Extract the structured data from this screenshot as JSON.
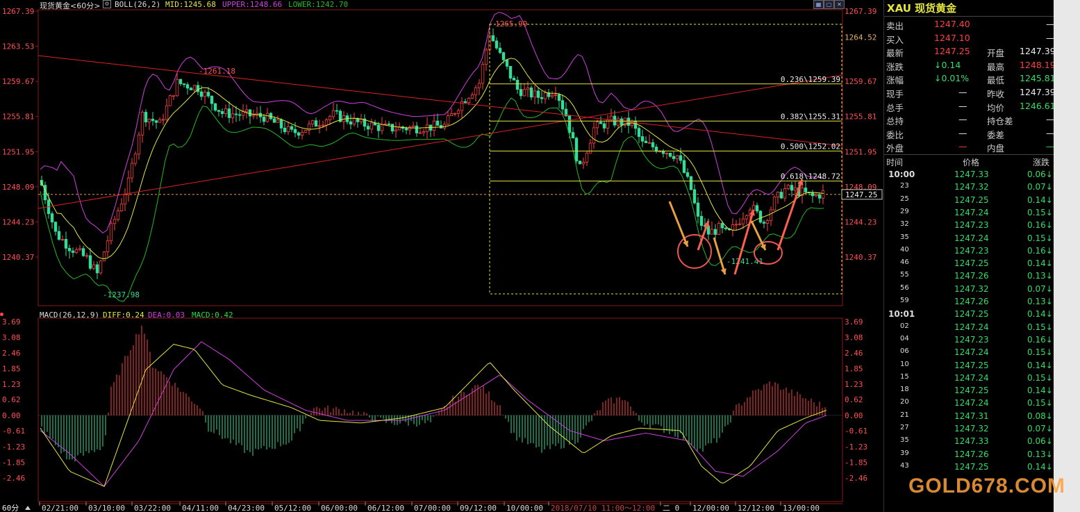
{
  "header": {
    "symbol_label": "现货黄金<60分>",
    "boll_label": "BOLL(26,2)",
    "mid_label": "MID:1245.68",
    "upper_label": "UPPER:1248.66",
    "lower_label": "LOWER:1242.70",
    "macd_label": "MACD(26,12,9)",
    "diff_label": "DIFF:0.24",
    "dea_label": "DEA:0.03",
    "macd_val_label": "MACD:0.42"
  },
  "colors": {
    "up": "#ff4444",
    "down": "#33dd99",
    "mid": "#e6e640",
    "upper": "#d040e0",
    "lower": "#22bb22",
    "fib": "#e6e640",
    "trend": "#dd2222",
    "price_text": "#ff5050"
  },
  "price_axis": {
    "left_labels": [
      "1267.39",
      "1263.53",
      "1259.67",
      "1255.81",
      "1251.95",
      "1248.09",
      "1244.23",
      "1240.37"
    ],
    "right_labels": [
      "1267.39",
      "1264.52",
      "1259.67",
      "1255.81",
      "1251.95",
      "1248.09",
      "1244.23",
      "1240.37"
    ],
    "current_price_box": "1247.25"
  },
  "macd_axis": {
    "left_labels": [
      "3.69",
      "3.08",
      "2.46",
      "1.85",
      "1.23",
      "0.62",
      "0.00",
      "-0.61",
      "-1.23",
      "-1.85",
      "-2.46"
    ],
    "right_labels": [
      "3.69",
      "3.08",
      "2.46",
      "1.85",
      "1.23",
      "0.62",
      "0.00",
      "-0.61",
      "-1.23",
      "-1.85",
      "-2.46"
    ]
  },
  "annotations": {
    "high_label": "1265.99",
    "swing_high_label": "1261.18",
    "low_label": "1237.98",
    "recent_low_label": "1241.41",
    "fib": [
      {
        "label": "0.236\\1259.39",
        "price": 1259.39
      },
      {
        "label": "0.382\\1255.31",
        "price": 1255.31
      },
      {
        "label": "0.500\\1252.02",
        "price": 1252.02
      },
      {
        "label": "0.618\\1248.72",
        "price": 1248.72
      }
    ]
  },
  "time_axis": {
    "period_label": "60分",
    "labels": [
      "02/21:00",
      "03/10:00",
      "03/22:00",
      "04/11:00",
      "04/23:00",
      "05/12:00",
      "06/00:00",
      "06/12:00",
      "07/00:00",
      "09/12:00",
      "10/00:00",
      "2018/07/10 11:00～12:00",
      "二 0",
      "12/00:00",
      "12/12:00",
      "13/00:00"
    ]
  },
  "side_panel": {
    "title": "XAU 现货黄金",
    "quote_rows": [
      {
        "l1": "卖出",
        "v1": "1247.40",
        "l2": "",
        "v2": "—",
        "c1": "red"
      },
      {
        "l1": "买入",
        "v1": "1247.10",
        "l2": "",
        "v2": "—",
        "c1": "red"
      },
      {
        "l1": "最新",
        "v1": "1247.25",
        "l2": "开盘",
        "v2": "1247.39",
        "c1": "red"
      },
      {
        "l1": "涨跌",
        "v1": "↓0.14",
        "l2": "最高",
        "v2": "1248.19",
        "c1": "green",
        "c2": "red"
      },
      {
        "l1": "涨幅",
        "v1": "↓0.01%",
        "l2": "最低",
        "v2": "1245.81",
        "c1": "green",
        "c2": "green"
      },
      {
        "l1": "现手",
        "v1": "—",
        "l2": "昨收",
        "v2": "1247.39"
      },
      {
        "l1": "总手",
        "v1": "—",
        "l2": "均价",
        "v2": "1246.61",
        "c2": "green"
      },
      {
        "l1": "总持",
        "v1": "—",
        "l2": "持仓差",
        "v2": "—"
      },
      {
        "l1": "委比",
        "v1": "—",
        "l2": "委差",
        "v2": "—"
      },
      {
        "l1": "外盘",
        "v1": "—",
        "l2": "内盘",
        "v2": "—",
        "c1": "red",
        "c2": "green"
      }
    ],
    "tick_headers": [
      "时间",
      "价格",
      "涨跌"
    ],
    "ticks": [
      {
        "t": "10:00",
        "p": "1247.33",
        "c": "0.06↓"
      },
      {
        "t": "23",
        "p": "1247.32",
        "c": "0.07↓"
      },
      {
        "t": "25",
        "p": "1247.25",
        "c": "0.14↓"
      },
      {
        "t": "29",
        "p": "1247.24",
        "c": "0.15↓"
      },
      {
        "t": "32",
        "p": "1247.23",
        "c": "0.16↓"
      },
      {
        "t": "35",
        "p": "1247.24",
        "c": "0.15↓"
      },
      {
        "t": "40",
        "p": "1247.23",
        "c": "0.16↓"
      },
      {
        "t": "46",
        "p": "1247.25",
        "c": "0.14↓"
      },
      {
        "t": "55",
        "p": "1247.26",
        "c": "0.13↓"
      },
      {
        "t": "56",
        "p": "1247.32",
        "c": "0.07↓"
      },
      {
        "t": "59",
        "p": "1247.26",
        "c": "0.13↓"
      },
      {
        "t": "10:01",
        "p": "1247.25",
        "c": "0.14↓"
      },
      {
        "t": "02",
        "p": "1247.24",
        "c": "0.15↓"
      },
      {
        "t": "04",
        "p": "1247.23",
        "c": "0.16↓"
      },
      {
        "t": "06",
        "p": "1247.24",
        "c": "0.15↓"
      },
      {
        "t": "10",
        "p": "1247.25",
        "c": "0.14↓"
      },
      {
        "t": "15",
        "p": "1247.24",
        "c": "0.15↓"
      },
      {
        "t": "18",
        "p": "1247.25",
        "c": "0.14↓"
      },
      {
        "t": "20",
        "p": "1247.24",
        "c": "0.15↓"
      },
      {
        "t": "21",
        "p": "1247.31",
        "c": "0.08↓"
      },
      {
        "t": "27",
        "p": "1247.32",
        "c": "0.07↓"
      },
      {
        "t": "35",
        "p": "1247.33",
        "c": "0.06↓"
      },
      {
        "t": "39",
        "p": "1247.26",
        "c": "0.13↓"
      },
      {
        "t": "43",
        "p": "1247.25",
        "c": "0.14↓"
      }
    ]
  },
  "watermark": "GOLD678.COM"
}
